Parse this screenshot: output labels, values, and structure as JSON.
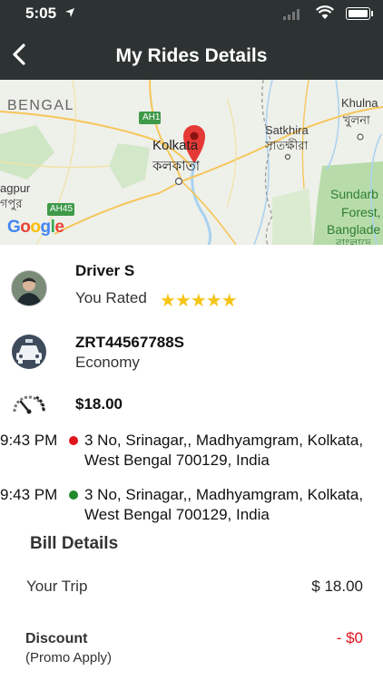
{
  "status": {
    "time": "5:05"
  },
  "nav": {
    "title": "My Rides Details"
  },
  "map": {
    "labels": {
      "bengal": "BENGAL",
      "kolkata_en": "Kolkata",
      "kolkata_bn": "কলকাতা",
      "satkhira_en": "Satkhira",
      "satkhira_bn": "সাতক্ষীরা",
      "khulna_en": "Khulna",
      "khulna_bn": "খুলনা",
      "sundarbans": "Sundarb",
      "forest": "Forest,",
      "bangladesh": "Banglade",
      "bangladesh_bn": "বাংলাদে",
      "agpur": "agpur",
      "agpur_bn": "গপুর",
      "ah1": "AH1",
      "ah45": "AH45"
    },
    "logo": "Google"
  },
  "driver": {
    "name": "Driver S",
    "rated_label": "You Rated",
    "stars": "★★★★★",
    "rating": 5
  },
  "vehicle": {
    "plate": "ZRT44567788S",
    "type": "Economy"
  },
  "fare": {
    "amount": "$18.00"
  },
  "stops": [
    {
      "time": "9:43 PM",
      "line1": "3 No, Srinagar,, Madhyamgram, Kolkata,",
      "line2": "West Bengal 700129, India",
      "color": "#e0141b"
    },
    {
      "time": "9:43 PM",
      "line1": "3 No, Srinagar,, Madhyamgram, Kolkata,",
      "line2": "West Bengal 700129, India",
      "color": "#1f8a2a"
    }
  ],
  "bill": {
    "heading": "Bill Details",
    "trip_label": "Your Trip",
    "trip_value": "$ 18.00",
    "discount_label": "Discount",
    "discount_note": "(Promo Apply)",
    "discount_value": "- $0"
  }
}
